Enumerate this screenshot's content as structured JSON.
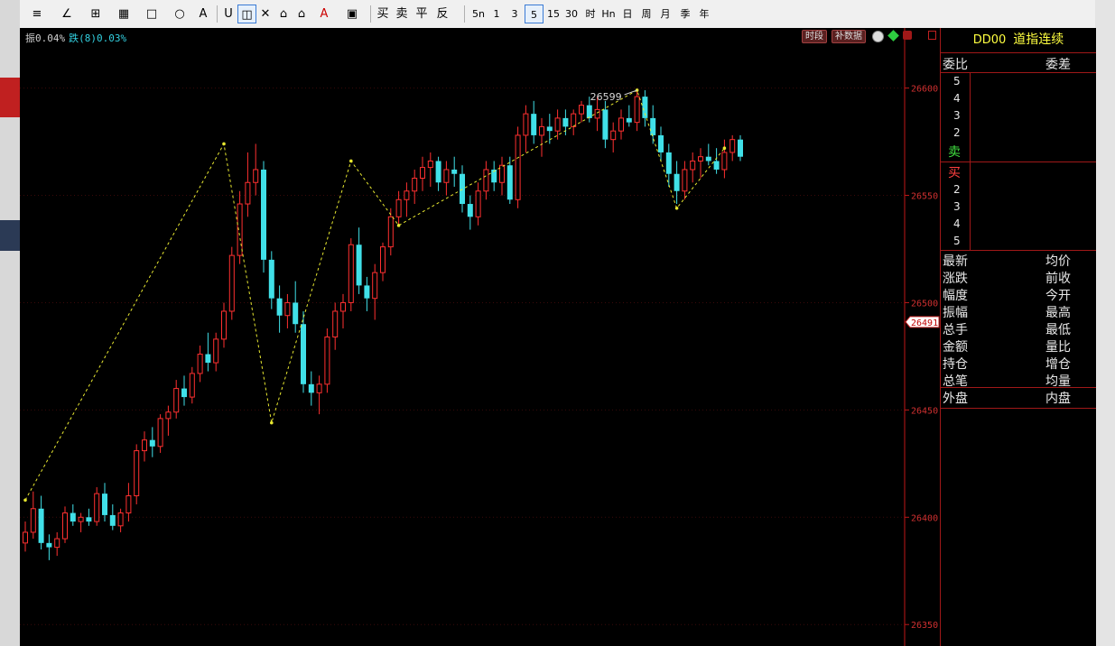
{
  "toolbar": {
    "draw_tools": [
      "≡",
      "∠",
      "⊞",
      "▦",
      "□",
      "○",
      "A",
      "U",
      "◫",
      "✕",
      "⌂",
      "⌂",
      "A",
      "▣"
    ],
    "trade": {
      "buy": "买",
      "sell": "卖",
      "flat": "平",
      "reverse": "反"
    },
    "periods": [
      "5n",
      "1",
      "3",
      "5",
      "15",
      "30",
      "时",
      "Hn",
      "日",
      "周",
      "月",
      "季",
      "年"
    ],
    "selected_period": "5"
  },
  "info_bar": {
    "amplitude": "振0.04%",
    "change": "跌(8)0.03%",
    "btn_period": "时段",
    "btn_supplement": "补数据"
  },
  "price_axis": {
    "labels": [
      "26600",
      "26550",
      "26500",
      "26450",
      "26400",
      "26350"
    ],
    "current": "26491"
  },
  "chart_data": {
    "type": "candlestick",
    "instrument": "DD00",
    "ylim": [
      26340,
      26628
    ],
    "peak_label": "26599",
    "candles": [
      {
        "o": 26388,
        "h": 26398,
        "l": 26384,
        "c": 26393
      },
      {
        "o": 26393,
        "h": 26412,
        "l": 26390,
        "c": 26404
      },
      {
        "o": 26404,
        "h": 26410,
        "l": 26385,
        "c": 26388
      },
      {
        "o": 26388,
        "h": 26392,
        "l": 26380,
        "c": 26386
      },
      {
        "o": 26386,
        "h": 26393,
        "l": 26382,
        "c": 26390
      },
      {
        "o": 26390,
        "h": 26405,
        "l": 26388,
        "c": 26402
      },
      {
        "o": 26402,
        "h": 26406,
        "l": 26396,
        "c": 26398
      },
      {
        "o": 26398,
        "h": 26402,
        "l": 26393,
        "c": 26400
      },
      {
        "o": 26400,
        "h": 26404,
        "l": 26396,
        "c": 26398
      },
      {
        "o": 26398,
        "h": 26414,
        "l": 26396,
        "c": 26411
      },
      {
        "o": 26411,
        "h": 26416,
        "l": 26398,
        "c": 26401
      },
      {
        "o": 26401,
        "h": 26406,
        "l": 26394,
        "c": 26396
      },
      {
        "o": 26396,
        "h": 26404,
        "l": 26393,
        "c": 26402
      },
      {
        "o": 26402,
        "h": 26416,
        "l": 26398,
        "c": 26410
      },
      {
        "o": 26410,
        "h": 26434,
        "l": 26406,
        "c": 26431
      },
      {
        "o": 26431,
        "h": 26440,
        "l": 26426,
        "c": 26436
      },
      {
        "o": 26436,
        "h": 26442,
        "l": 26428,
        "c": 26433
      },
      {
        "o": 26433,
        "h": 26448,
        "l": 26430,
        "c": 26446
      },
      {
        "o": 26446,
        "h": 26452,
        "l": 26438,
        "c": 26449
      },
      {
        "o": 26449,
        "h": 26464,
        "l": 26446,
        "c": 26460
      },
      {
        "o": 26460,
        "h": 26466,
        "l": 26452,
        "c": 26456
      },
      {
        "o": 26456,
        "h": 26470,
        "l": 26453,
        "c": 26467
      },
      {
        "o": 26467,
        "h": 26480,
        "l": 26463,
        "c": 26476
      },
      {
        "o": 26476,
        "h": 26486,
        "l": 26468,
        "c": 26472
      },
      {
        "o": 26472,
        "h": 26486,
        "l": 26468,
        "c": 26483
      },
      {
        "o": 26483,
        "h": 26500,
        "l": 26479,
        "c": 26496
      },
      {
        "o": 26496,
        "h": 26526,
        "l": 26492,
        "c": 26522
      },
      {
        "o": 26522,
        "h": 26552,
        "l": 26518,
        "c": 26546
      },
      {
        "o": 26546,
        "h": 26570,
        "l": 26540,
        "c": 26556
      },
      {
        "o": 26556,
        "h": 26574,
        "l": 26550,
        "c": 26562
      },
      {
        "o": 26562,
        "h": 26566,
        "l": 26514,
        "c": 26520
      },
      {
        "o": 26520,
        "h": 26524,
        "l": 26497,
        "c": 26502
      },
      {
        "o": 26502,
        "h": 26508,
        "l": 26486,
        "c": 26494
      },
      {
        "o": 26494,
        "h": 26504,
        "l": 26488,
        "c": 26500
      },
      {
        "o": 26500,
        "h": 26510,
        "l": 26486,
        "c": 26490
      },
      {
        "o": 26490,
        "h": 26496,
        "l": 26458,
        "c": 26462
      },
      {
        "o": 26462,
        "h": 26468,
        "l": 26452,
        "c": 26458
      },
      {
        "o": 26458,
        "h": 26466,
        "l": 26448,
        "c": 26462
      },
      {
        "o": 26462,
        "h": 26488,
        "l": 26458,
        "c": 26484
      },
      {
        "o": 26484,
        "h": 26500,
        "l": 26478,
        "c": 26496
      },
      {
        "o": 26496,
        "h": 26504,
        "l": 26488,
        "c": 26500
      },
      {
        "o": 26500,
        "h": 26530,
        "l": 26496,
        "c": 26527
      },
      {
        "o": 26527,
        "h": 26535,
        "l": 26504,
        "c": 26508
      },
      {
        "o": 26508,
        "h": 26512,
        "l": 26496,
        "c": 26502
      },
      {
        "o": 26502,
        "h": 26518,
        "l": 26492,
        "c": 26514
      },
      {
        "o": 26514,
        "h": 26528,
        "l": 26510,
        "c": 26526
      },
      {
        "o": 26526,
        "h": 26544,
        "l": 26522,
        "c": 26540
      },
      {
        "o": 26540,
        "h": 26552,
        "l": 26536,
        "c": 26548
      },
      {
        "o": 26548,
        "h": 26556,
        "l": 26540,
        "c": 26552
      },
      {
        "o": 26552,
        "h": 26562,
        "l": 26546,
        "c": 26558
      },
      {
        "o": 26558,
        "h": 26568,
        "l": 26552,
        "c": 26563
      },
      {
        "o": 26563,
        "h": 26570,
        "l": 26554,
        "c": 26566
      },
      {
        "o": 26566,
        "h": 26568,
        "l": 26552,
        "c": 26556
      },
      {
        "o": 26556,
        "h": 26566,
        "l": 26550,
        "c": 26562
      },
      {
        "o": 26562,
        "h": 26568,
        "l": 26554,
        "c": 26560
      },
      {
        "o": 26560,
        "h": 26564,
        "l": 26542,
        "c": 26546
      },
      {
        "o": 26546,
        "h": 26550,
        "l": 26534,
        "c": 26540
      },
      {
        "o": 26540,
        "h": 26556,
        "l": 26536,
        "c": 26552
      },
      {
        "o": 26552,
        "h": 26566,
        "l": 26548,
        "c": 26562
      },
      {
        "o": 26562,
        "h": 26566,
        "l": 26552,
        "c": 26556
      },
      {
        "o": 26556,
        "h": 26568,
        "l": 26550,
        "c": 26564
      },
      {
        "o": 26564,
        "h": 26568,
        "l": 26546,
        "c": 26548
      },
      {
        "o": 26548,
        "h": 26582,
        "l": 26544,
        "c": 26578
      },
      {
        "o": 26578,
        "h": 26592,
        "l": 26570,
        "c": 26588
      },
      {
        "o": 26588,
        "h": 26594,
        "l": 26574,
        "c": 26578
      },
      {
        "o": 26578,
        "h": 26586,
        "l": 26568,
        "c": 26582
      },
      {
        "o": 26582,
        "h": 26588,
        "l": 26574,
        "c": 26580
      },
      {
        "o": 26580,
        "h": 26590,
        "l": 26576,
        "c": 26586
      },
      {
        "o": 26586,
        "h": 26590,
        "l": 26578,
        "c": 26582
      },
      {
        "o": 26582,
        "h": 26590,
        "l": 26578,
        "c": 26588
      },
      {
        "o": 26588,
        "h": 26594,
        "l": 26584,
        "c": 26592
      },
      {
        "o": 26592,
        "h": 26596,
        "l": 26584,
        "c": 26586
      },
      {
        "o": 26586,
        "h": 26596,
        "l": 26580,
        "c": 26590
      },
      {
        "o": 26590,
        "h": 26594,
        "l": 26572,
        "c": 26576
      },
      {
        "o": 26576,
        "h": 26584,
        "l": 26570,
        "c": 26580
      },
      {
        "o": 26580,
        "h": 26590,
        "l": 26576,
        "c": 26586
      },
      {
        "o": 26586,
        "h": 26592,
        "l": 26582,
        "c": 26584
      },
      {
        "o": 26584,
        "h": 26599,
        "l": 26580,
        "c": 26596
      },
      {
        "o": 26596,
        "h": 26599,
        "l": 26582,
        "c": 26586
      },
      {
        "o": 26586,
        "h": 26592,
        "l": 26574,
        "c": 26578
      },
      {
        "o": 26578,
        "h": 26582,
        "l": 26566,
        "c": 26570
      },
      {
        "o": 26570,
        "h": 26574,
        "l": 26554,
        "c": 26560
      },
      {
        "o": 26560,
        "h": 26566,
        "l": 26546,
        "c": 26552
      },
      {
        "o": 26552,
        "h": 26566,
        "l": 26548,
        "c": 26562
      },
      {
        "o": 26562,
        "h": 26570,
        "l": 26556,
        "c": 26566
      },
      {
        "o": 26566,
        "h": 26572,
        "l": 26558,
        "c": 26568
      },
      {
        "o": 26568,
        "h": 26574,
        "l": 26564,
        "c": 26566
      },
      {
        "o": 26566,
        "h": 26572,
        "l": 26560,
        "c": 26562
      },
      {
        "o": 26562,
        "h": 26576,
        "l": 26558,
        "c": 26570
      },
      {
        "o": 26570,
        "h": 26578,
        "l": 26566,
        "c": 26576
      },
      {
        "o": 26576,
        "h": 26578,
        "l": 26566,
        "c": 26568
      }
    ],
    "zigzag": [
      {
        "i": 0,
        "p": 26408
      },
      {
        "i": 25,
        "p": 26574
      },
      {
        "i": 31,
        "p": 26444
      },
      {
        "i": 41,
        "p": 26566
      },
      {
        "i": 47,
        "p": 26536
      },
      {
        "i": 77,
        "p": 26599
      },
      {
        "i": 82,
        "p": 26544
      },
      {
        "i": 88,
        "p": 26572
      }
    ]
  },
  "panel": {
    "code": "DD00",
    "name": "道指连续",
    "wei_bi": "委比",
    "wei_cha": "委差",
    "ask_levels": [
      "5",
      "4",
      "3",
      "2"
    ],
    "sell_label": "卖",
    "buy_label": "买",
    "bid_levels": [
      "2",
      "3",
      "4",
      "5"
    ],
    "stats_left": [
      "最新",
      "涨跌",
      "幅度",
      "振幅",
      "总手",
      "金额",
      "持仓",
      "总笔"
    ],
    "stats_right": [
      "均价",
      "前收",
      "今开",
      "最高",
      "最低",
      "量比",
      "增仓",
      "均量"
    ],
    "outer": "外盘",
    "inner": "内盘"
  },
  "colors": {
    "up": "#ff3030",
    "down": "#40e0e8",
    "axis": "#c01818",
    "zigzag": "#e8e830"
  }
}
